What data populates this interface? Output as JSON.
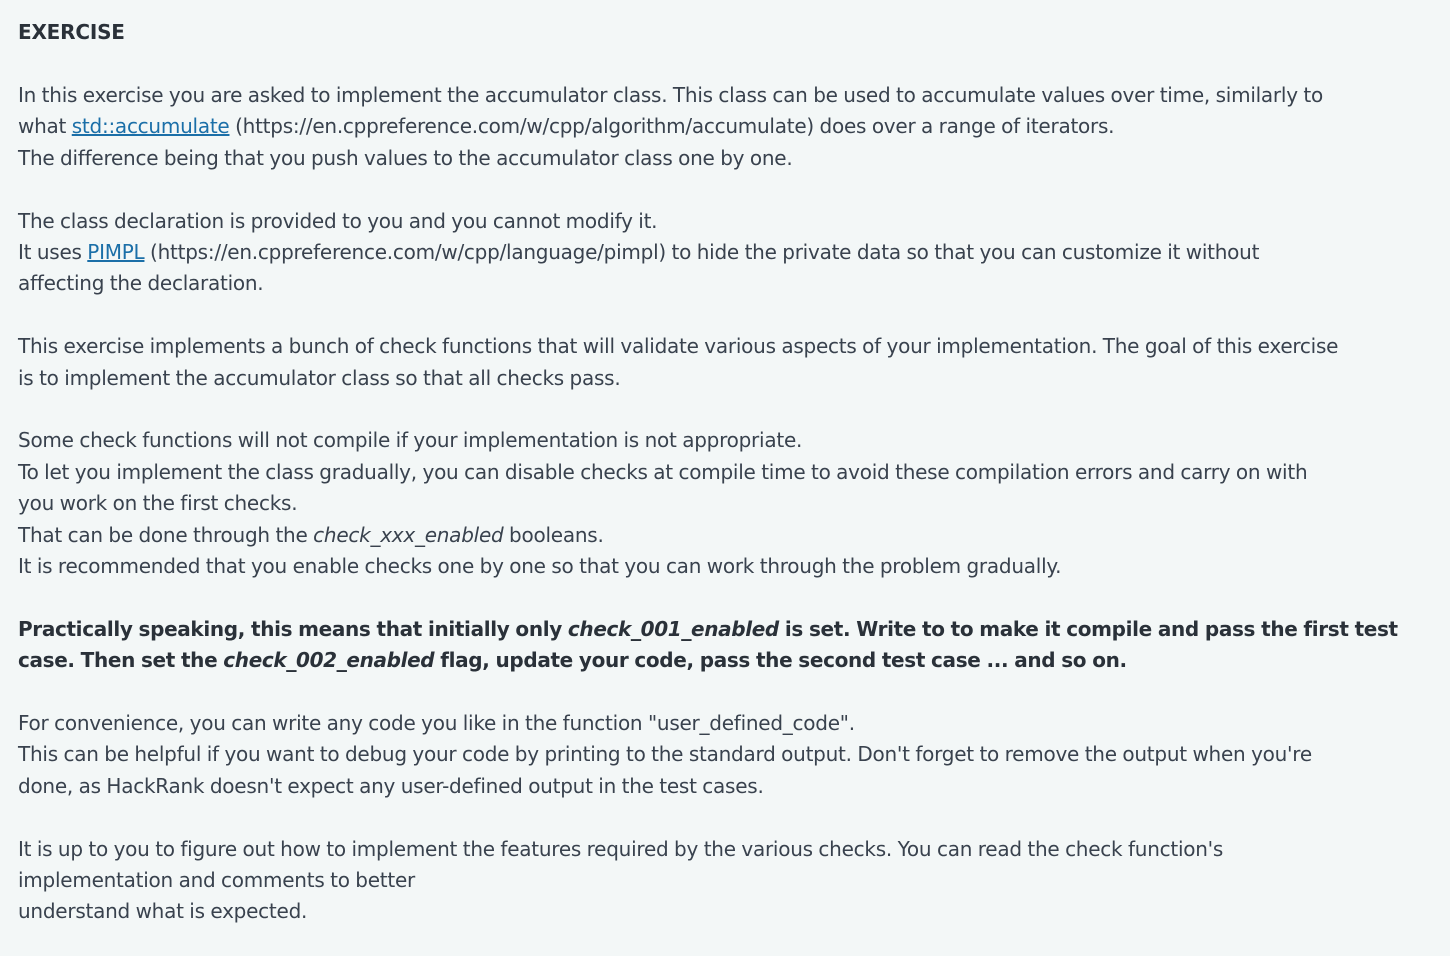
{
  "heading": "EXERCISE",
  "p1": {
    "l1": "In this exercise you are asked to implement the accumulator class. This class can be used to accumulate values over time, similarly to",
    "l2_pre": "what ",
    "l2_link": "std::accumulate",
    "l2_post": " (https://en.cppreference.com/w/cpp/algorithm/accumulate) does over a range of iterators.",
    "l3": "The difference being that you push values to the accumulator class one by one."
  },
  "p2": {
    "l1": "The class declaration is provided to you and you cannot modify it.",
    "l2_pre": "It uses ",
    "l2_link": "PIMPL",
    "l2_post": " (https://en.cppreference.com/w/cpp/language/pimpl) to hide the private data so that you can customize it without",
    "l3": "affecting the declaration."
  },
  "p3": {
    "l1": "This exercise implements a bunch of check functions that will validate various aspects of your implementation. The goal of this exercise",
    "l2": "is to implement the accumulator class so that all checks pass."
  },
  "p4": {
    "l1": "Some check functions will not compile if your implementation is not appropriate.",
    "l2": "To let you implement the class gradually, you can disable checks at compile time to avoid these compilation errors and carry on with",
    "l3": "you work on the first checks.",
    "l4_pre": "That can be done through the ",
    "l4_ital": "check_xxx_enabled",
    "l4_post": " booleans.",
    "l5": "It is recommended that you enable checks one by one so that you can work through the problem gradually."
  },
  "p5": {
    "l1_pre": "Practically speaking, this means that initially only ",
    "l1_ital": "check_001_enabled",
    "l1_post": " is set. Write to to make it compile and pass the first test",
    "l2_pre": "case. Then set the ",
    "l2_ital": "check_002_enabled",
    "l2_post": " flag, update your code, pass the second test case ... and so on."
  },
  "p6": {
    "l1": "For convenience, you can write any code you like in the function \"user_defined_code\".",
    "l2": "This can be helpful if you want to debug your code by printing to the standard output. Don't forget to remove the output when you're",
    "l3": "done, as HackRank doesn't expect any user-defined output in the test cases."
  },
  "p7": {
    "l1": "It is up to you to figure out how to implement the features required by the various checks. You can read the check function's",
    "l2": "implementation and comments to better",
    "l3": "understand what is expected."
  }
}
